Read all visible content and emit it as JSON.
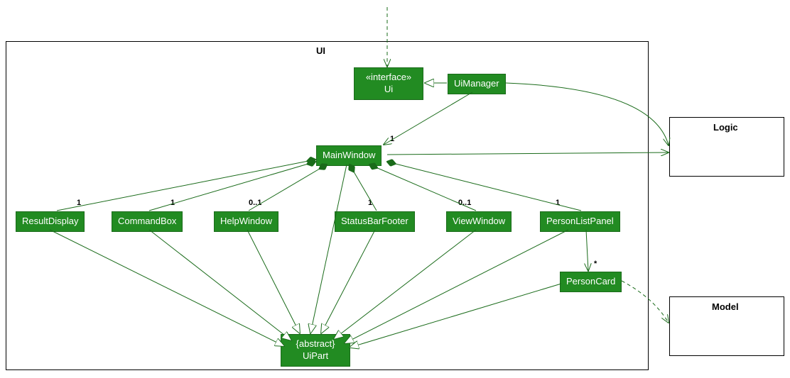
{
  "packages": {
    "ui": {
      "label": "UI"
    },
    "logic": {
      "label": "Logic"
    },
    "model": {
      "label": "Model"
    }
  },
  "classes": {
    "ui_interface": {
      "stereotype": "«interface»",
      "name": "Ui"
    },
    "ui_manager": {
      "name": "UiManager"
    },
    "main_window": {
      "name": "MainWindow"
    },
    "result_display": {
      "name": "ResultDisplay"
    },
    "command_box": {
      "name": "CommandBox"
    },
    "help_window": {
      "name": "HelpWindow"
    },
    "status_bar_footer": {
      "name": "StatusBarFooter"
    },
    "view_window": {
      "name": "ViewWindow"
    },
    "person_list_panel": {
      "name": "PersonListPanel"
    },
    "person_card": {
      "name": "PersonCard"
    },
    "ui_part": {
      "stereotype": "{abstract}",
      "name": "UiPart"
    }
  },
  "multiplicities": {
    "main_window_mult": "1",
    "result_display_mult": "1",
    "command_box_mult": "1",
    "help_window_mult": "0..1",
    "status_bar_footer_mult": "1",
    "view_window_mult": "0..1",
    "person_list_panel_mult": "1",
    "person_card_mult": "*"
  },
  "chart_data": {
    "type": "uml_class_diagram",
    "packages": [
      "UI",
      "Logic",
      "Model"
    ],
    "classes": [
      {
        "name": "Ui",
        "stereotype": "interface",
        "package": "UI"
      },
      {
        "name": "UiManager",
        "package": "UI"
      },
      {
        "name": "MainWindow",
        "package": "UI"
      },
      {
        "name": "ResultDisplay",
        "package": "UI"
      },
      {
        "name": "CommandBox",
        "package": "UI"
      },
      {
        "name": "HelpWindow",
        "package": "UI"
      },
      {
        "name": "StatusBarFooter",
        "package": "UI"
      },
      {
        "name": "ViewWindow",
        "package": "UI"
      },
      {
        "name": "PersonListPanel",
        "package": "UI"
      },
      {
        "name": "PersonCard",
        "package": "UI"
      },
      {
        "name": "UiPart",
        "stereotype": "abstract",
        "package": "UI"
      },
      {
        "name": "Logic",
        "package": "Logic"
      },
      {
        "name": "Model",
        "package": "Model"
      }
    ],
    "relationships": [
      {
        "from": "external",
        "to": "Ui",
        "type": "dependency"
      },
      {
        "from": "UiManager",
        "to": "Ui",
        "type": "realization"
      },
      {
        "from": "UiManager",
        "to": "MainWindow",
        "type": "association",
        "multiplicity": "1"
      },
      {
        "from": "UiManager",
        "to": "Logic",
        "type": "association"
      },
      {
        "from": "MainWindow",
        "to": "Logic",
        "type": "association"
      },
      {
        "from": "MainWindow",
        "to": "ResultDisplay",
        "type": "composition",
        "multiplicity": "1"
      },
      {
        "from": "MainWindow",
        "to": "CommandBox",
        "type": "composition",
        "multiplicity": "1"
      },
      {
        "from": "MainWindow",
        "to": "HelpWindow",
        "type": "composition",
        "multiplicity": "0..1"
      },
      {
        "from": "MainWindow",
        "to": "StatusBarFooter",
        "type": "composition",
        "multiplicity": "1"
      },
      {
        "from": "MainWindow",
        "to": "ViewWindow",
        "type": "composition",
        "multiplicity": "0..1"
      },
      {
        "from": "MainWindow",
        "to": "PersonListPanel",
        "type": "composition",
        "multiplicity": "1"
      },
      {
        "from": "PersonListPanel",
        "to": "PersonCard",
        "type": "association",
        "multiplicity": "*"
      },
      {
        "from": "PersonCard",
        "to": "Model",
        "type": "dependency"
      },
      {
        "from": "MainWindow",
        "to": "UiPart",
        "type": "generalization"
      },
      {
        "from": "ResultDisplay",
        "to": "UiPart",
        "type": "generalization"
      },
      {
        "from": "CommandBox",
        "to": "UiPart",
        "type": "generalization"
      },
      {
        "from": "HelpWindow",
        "to": "UiPart",
        "type": "generalization"
      },
      {
        "from": "StatusBarFooter",
        "to": "UiPart",
        "type": "generalization"
      },
      {
        "from": "ViewWindow",
        "to": "UiPart",
        "type": "generalization"
      },
      {
        "from": "PersonListPanel",
        "to": "UiPart",
        "type": "generalization"
      },
      {
        "from": "PersonCard",
        "to": "UiPart",
        "type": "generalization"
      }
    ]
  }
}
